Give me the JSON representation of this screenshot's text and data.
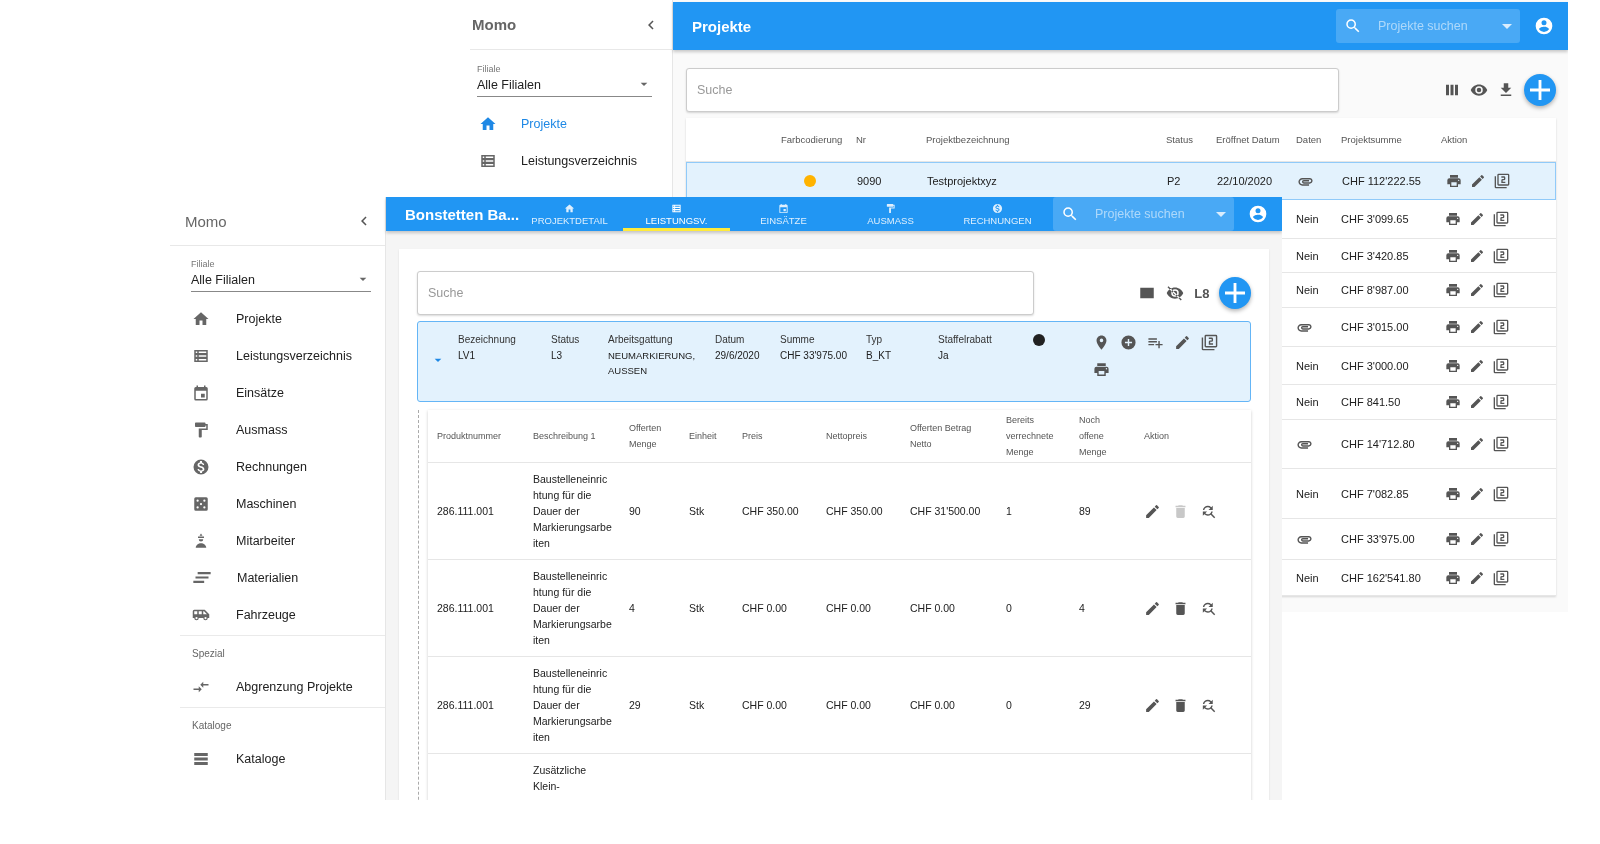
{
  "back_window": {
    "sidebar": {
      "title": "Momo",
      "filiale": {
        "label": "Filiale",
        "value": "Alle Filialen"
      },
      "items": [
        {
          "label": "Projekte",
          "selected": true
        },
        {
          "label": "Leistungsverzeichnis",
          "selected": false
        }
      ]
    },
    "app_bar": {
      "title": "Projekte",
      "search_placeholder": "Projekte suchen"
    },
    "search": {
      "placeholder": "Suche"
    },
    "table": {
      "columns": [
        "Farbcodierung",
        "Nr",
        "Projektbezeichnung",
        "Status",
        "Eröffnet Datum",
        "Daten",
        "Projektsumme",
        "Aktion"
      ],
      "rows": [
        {
          "selected": true,
          "color": "#ffb300",
          "nr": "9090",
          "name": "Testprojektxyz",
          "status": "P2",
          "datum": "22/10/2020",
          "daten": {
            "kind": "attachment"
          },
          "summe": "CHF 112'222.55"
        },
        {
          "selected": false,
          "daten": {
            "kind": "text",
            "text": "Nein"
          },
          "summe": "CHF 3'099.65"
        },
        {
          "selected": false,
          "daten": {
            "kind": "text",
            "text": "Nein"
          },
          "summe": "CHF 3'420.85"
        },
        {
          "selected": false,
          "daten": {
            "kind": "text",
            "text": "Nein"
          },
          "summe": "CHF 8'987.00"
        },
        {
          "selected": false,
          "daten": {
            "kind": "attachment"
          },
          "summe": "CHF 3'015.00"
        },
        {
          "selected": false,
          "daten": {
            "kind": "text",
            "text": "Nein"
          },
          "summe": "CHF 3'000.00"
        },
        {
          "selected": false,
          "daten": {
            "kind": "text",
            "text": "Nein"
          },
          "summe": "CHF 841.50"
        },
        {
          "selected": false,
          "daten": {
            "kind": "attachment"
          },
          "summe": "CHF 14'712.80"
        },
        {
          "selected": false,
          "daten": {
            "kind": "text",
            "text": "Nein"
          },
          "summe": "CHF 7'082.85"
        },
        {
          "selected": false,
          "daten": {
            "kind": "attachment"
          },
          "summe": "CHF 33'975.00"
        },
        {
          "selected": false,
          "daten": {
            "kind": "text",
            "text": "Nein"
          },
          "summe": "CHF 162'541.80"
        }
      ]
    }
  },
  "front_window": {
    "sidebar": {
      "title": "Momo",
      "filiale": {
        "label": "Filiale",
        "value": "Alle Filialen"
      },
      "items": [
        {
          "label": "Projekte",
          "selected": false
        },
        {
          "label": "Leistungsverzeichnis",
          "selected": false
        },
        {
          "label": "Einsätze",
          "selected": false
        },
        {
          "label": "Ausmass",
          "selected": false
        },
        {
          "label": "Rechnungen",
          "selected": false
        },
        {
          "label": "Maschinen",
          "selected": false
        },
        {
          "label": "Mitarbeiter",
          "selected": false
        },
        {
          "label": "Materialien",
          "selected": false
        },
        {
          "label": "Fahrzeuge",
          "selected": false
        }
      ],
      "sections": [
        {
          "title": "Spezial",
          "items": [
            {
              "label": "Abgrenzung Projekte",
              "selected": false
            }
          ]
        },
        {
          "title": "Kataloge",
          "items": [
            {
              "label": "Kataloge",
              "selected": false
            }
          ]
        }
      ]
    },
    "app_bar": {
      "title": "Bonstetten Ba...",
      "search_placeholder": "Projekte suchen",
      "tabs": [
        {
          "label": "PROJEKTDETAIL",
          "selected": false
        },
        {
          "label": "LEISTUNGSV.",
          "selected": true
        },
        {
          "label": "EINSÄTZE",
          "selected": false
        },
        {
          "label": "AUSMASS",
          "selected": false
        },
        {
          "label": "RECHNUNGEN",
          "selected": false
        }
      ]
    },
    "search": {
      "placeholder": "Suche"
    },
    "toolbar_label": "L8",
    "lv": {
      "expanded": true,
      "fields": [
        {
          "label": "Bezeichnung",
          "value": "LV1"
        },
        {
          "label": "Status",
          "value": "L3"
        },
        {
          "label": "Arbeitsgattung",
          "value": "NEUMARKIERUNG, AUSSEN"
        },
        {
          "label": "Datum",
          "value": "29/6/2020"
        },
        {
          "label": "Summe",
          "value": "CHF 33'975.00"
        },
        {
          "label": "Typ",
          "value": "B_KT"
        },
        {
          "label": "Staffelrabatt",
          "value": "Ja"
        }
      ]
    },
    "table": {
      "columns": [
        "Produktnummer",
        "Beschreibung 1",
        "Offerten Menge",
        "Einheit",
        "Preis",
        "Nettopreis",
        "Offerten Betrag Netto",
        "Bereits verrechnete Menge",
        "Noch offene Menge",
        "Aktion"
      ],
      "rows": [
        {
          "cells": [
            "286.111.001",
            "Baustelleneinrichtung für die Dauer der Markierungsarbeiten",
            "90",
            "Stk",
            "CHF 350.00",
            "CHF 350.00",
            "CHF 31'500.00",
            "1",
            "89"
          ],
          "delete_disabled": true
        },
        {
          "cells": [
            "286.111.001",
            "Baustelleneinrichtung für die Dauer der Markierungsarbeiten",
            "4",
            "Stk",
            "CHF 0.00",
            "CHF 0.00",
            "CHF 0.00",
            "0",
            "4"
          ],
          "delete_disabled": false
        },
        {
          "cells": [
            "286.111.001",
            "Baustelleneinrichtung für die Dauer der Markierungsarbeiten",
            "29",
            "Stk",
            "CHF 0.00",
            "CHF 0.00",
            "CHF 0.00",
            "0",
            "29"
          ],
          "delete_disabled": false
        }
      ],
      "partial_row": {
        "description": "Zusätzliche Klein-"
      }
    }
  }
}
